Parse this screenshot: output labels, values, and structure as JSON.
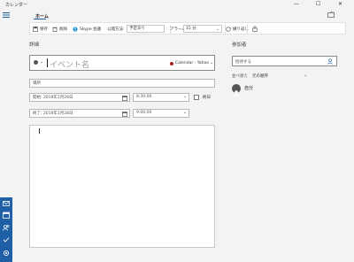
{
  "window": {
    "title": "カレンダー",
    "minimize_glyph": "—",
    "maximize_glyph": "☐",
    "close_glyph": "✕"
  },
  "tabs": [
    {
      "label": "ホーム"
    }
  ],
  "toolbar": {
    "save_label": "保存",
    "delete_label": "削除",
    "skype_label": "Skype 会議",
    "show_as_label": "公開方法:",
    "show_as_value": "予定あり",
    "alarm_label": "アラーム:",
    "alarm_value": "15 分",
    "repeat_label": "繰り返し"
  },
  "details": {
    "section_label": "詳細",
    "event_name_placeholder": "イベント名",
    "calendar_name": "Calendar - Yahoo",
    "location_placeholder": "場所",
    "start_label": "開始: 2019年1月28日",
    "start_time": "8:30:00",
    "all_day_label": "終日",
    "end_label": "終了: 2019年1月28日",
    "end_time": "9:00:00"
  },
  "attendees": {
    "section_label": "参加者",
    "search_placeholder": "招待する",
    "sort_label": "並べ替え",
    "sort_value": "元の順序",
    "me_name": "自分"
  },
  "colors": {
    "accent": "#1f5fa6",
    "calendar_dot": "#a0241c"
  },
  "icons": {
    "app": "calendar-icon",
    "sidebar": [
      "mail-icon",
      "calendar-icon",
      "people-icon",
      "todo-icon",
      "settings-icon"
    ]
  }
}
